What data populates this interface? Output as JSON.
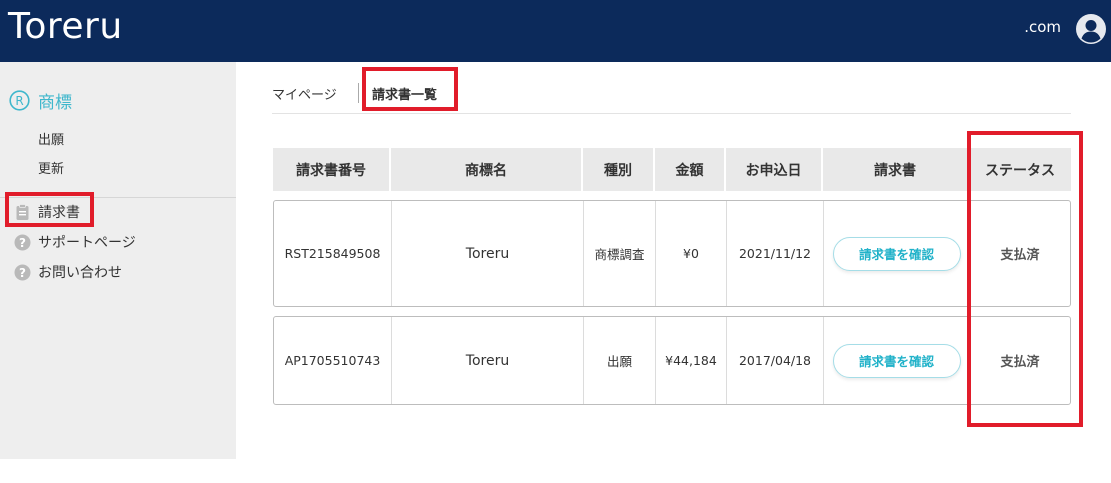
{
  "header": {
    "logo": "Toreru",
    "domain": ".com"
  },
  "sidebar": {
    "section_title": "商標",
    "sub_items": [
      "出願",
      "更新"
    ],
    "items": [
      {
        "label": "請求書",
        "icon": "clipboard-icon"
      },
      {
        "label": "サポートページ",
        "icon": "question-icon"
      },
      {
        "label": "お問い合わせ",
        "icon": "question-icon"
      }
    ]
  },
  "tabs": [
    "マイページ",
    "請求書一覧"
  ],
  "table": {
    "headers": [
      "請求書番号",
      "商標名",
      "種別",
      "金額",
      "お申込日",
      "請求書",
      "ステータス"
    ],
    "rows": [
      {
        "invoice_no": "RST215849508",
        "trademark": "Toreru",
        "type": "商標調査",
        "amount": "¥0",
        "date": "2021/11/12",
        "button": "請求書を確認",
        "status": "支払済"
      },
      {
        "invoice_no": "AP1705510743",
        "trademark": "Toreru",
        "type": "出願",
        "amount": "¥44,184",
        "date": "2017/04/18",
        "button": "請求書を確認",
        "status": "支払済"
      }
    ]
  },
  "colors": {
    "header_bg": "#0c2a5b",
    "accent": "#3fb7cc",
    "highlight": "#e11c2a",
    "sidebar_bg": "#eeeeee"
  }
}
